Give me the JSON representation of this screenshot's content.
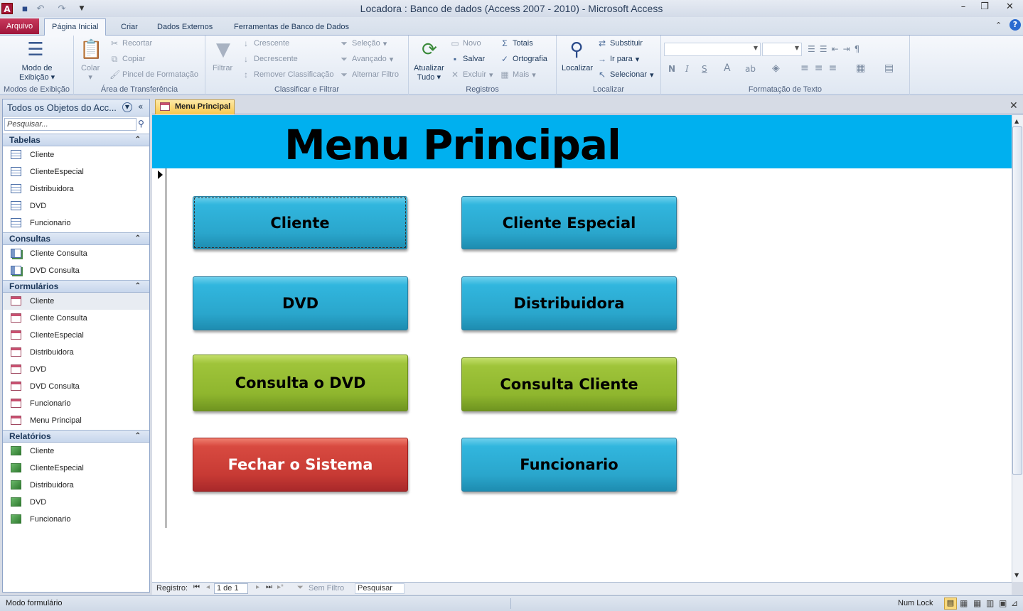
{
  "window": {
    "title": "Locadora : Banco de dados (Access 2007 - 2010)  -  Microsoft Access"
  },
  "ribbon_tabs": {
    "file": "Arquivo",
    "home": "Página Inicial",
    "create": "Criar",
    "external": "Dados Externos",
    "dbtools": "Ferramentas de Banco de Dados"
  },
  "ribbon": {
    "views": {
      "view_btn_line1": "Modo de",
      "view_btn_line2": "Exibição",
      "label": "Modos de Exibição"
    },
    "clipboard": {
      "paste": "Colar",
      "cut": "Recortar",
      "copy": "Copiar",
      "format_painter": "Pincel de Formatação",
      "label": "Área de Transferência"
    },
    "sort_filter": {
      "filter": "Filtrar",
      "ascending": "Crescente",
      "descending": "Decrescente",
      "remove_sort": "Remover Classificação",
      "selection": "Seleção",
      "advanced": "Avançado",
      "toggle_filter": "Alternar Filtro",
      "label": "Classificar e Filtrar"
    },
    "records": {
      "refresh_line1": "Atualizar",
      "refresh_line2": "Tudo",
      "new": "Novo",
      "save": "Salvar",
      "delete": "Excluir",
      "totals": "Totais",
      "spelling": "Ortografia",
      "more": "Mais",
      "label": "Registros"
    },
    "find": {
      "find": "Localizar",
      "replace": "Substituir",
      "goto": "Ir para",
      "select": "Selecionar",
      "label": "Localizar"
    },
    "text_format": {
      "bold": "N",
      "italic": "I",
      "underline": "S",
      "label": "Formatação de Texto"
    }
  },
  "nav_pane": {
    "title": "Todos os Objetos do Acc...",
    "search_placeholder": "Pesquisar...",
    "sections": {
      "tables": {
        "title": "Tabelas",
        "items": [
          "Cliente",
          "ClienteEspecial",
          "Distribuidora",
          "DVD",
          "Funcionario"
        ]
      },
      "queries": {
        "title": "Consultas",
        "items": [
          "Cliente Consulta",
          "DVD Consulta"
        ]
      },
      "forms": {
        "title": "Formulários",
        "items": [
          "Cliente",
          "Cliente Consulta",
          "ClienteEspecial",
          "Distribuidora",
          "DVD",
          "DVD Consulta",
          "Funcionario",
          "Menu Principal"
        ]
      },
      "reports": {
        "title": "Relatórios",
        "items": [
          "Cliente",
          "ClienteEspecial",
          "Distribuidora",
          "DVD",
          "Funcionario"
        ]
      }
    }
  },
  "document": {
    "tab_label": "Menu Principal",
    "form_title": "Menu Principal",
    "buttons": {
      "cliente": "Cliente",
      "cliente_especial": "Cliente Especial",
      "dvd": "DVD",
      "distribuidora": "Distribuidora",
      "consulta_dvd": "Consulta o DVD",
      "consulta_cliente": "Consulta Cliente",
      "fechar": "Fechar o Sistema",
      "funcionario": "Funcionario"
    },
    "colors": {
      "header": "#00b0ef",
      "blue_button": "#2aa6cc",
      "green_button": "#8fb62e",
      "red_button": "#c73a34"
    }
  },
  "record_nav": {
    "label": "Registro:",
    "position": "1 de 1",
    "filter": "Sem Filtro",
    "search": "Pesquisar"
  },
  "status_bar": {
    "mode": "Modo formulário",
    "numlock": "Num Lock"
  }
}
